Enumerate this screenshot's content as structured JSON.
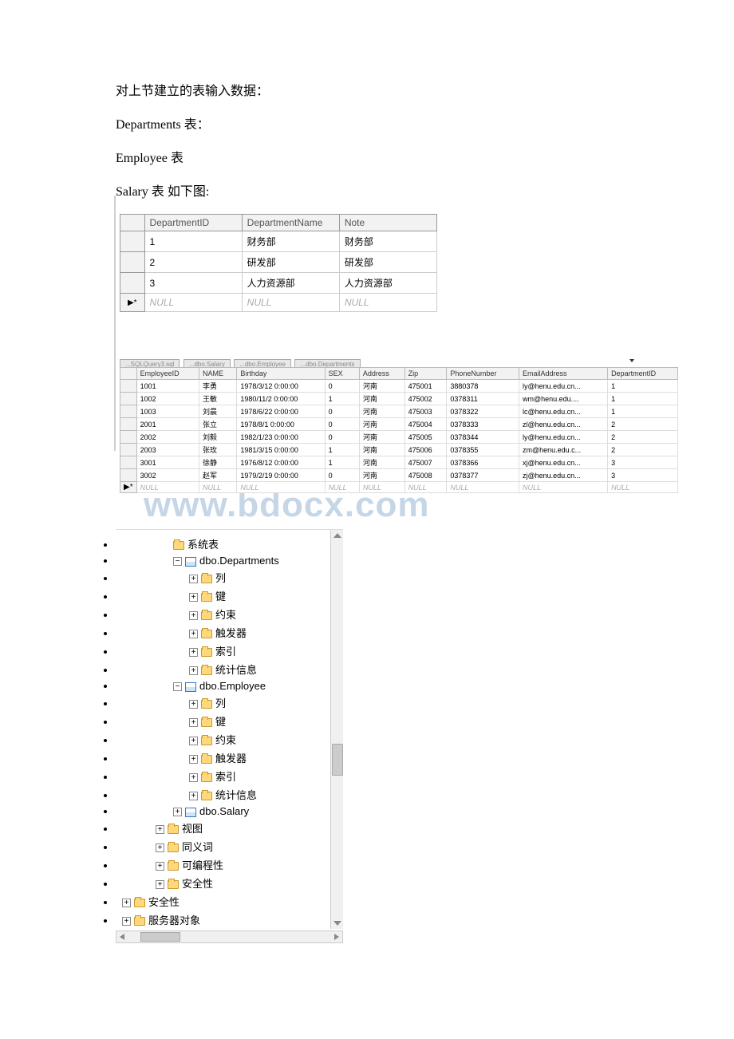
{
  "intro": {
    "line1": "对上节建立的表输入数据：",
    "line2": "Departments 表：",
    "line3": "Employee 表",
    "line4": "Salary 表 如下图:"
  },
  "watermark": "www.bdocx.com",
  "departments": {
    "headers": [
      "DepartmentID",
      "DepartmentName",
      "Note"
    ],
    "rows": [
      {
        "id": "1",
        "name": "财务部",
        "note": "财务部"
      },
      {
        "id": "2",
        "name": "研发部",
        "note": "研发部"
      },
      {
        "id": "3",
        "name": "人力资源部",
        "note": "人力资源部"
      }
    ],
    "null": "NULL",
    "marker": "▶*"
  },
  "employee_tabs": [
    "...SQLQuery3.sql",
    "...dbo.Salary",
    "...dbo.Employee",
    "...dbo.Departments"
  ],
  "employee": {
    "headers": [
      "EmployeeID",
      "NAME",
      "Birthday",
      "SEX",
      "Address",
      "Zip",
      "PhoneNumber",
      "EmailAddress",
      "DepartmentID"
    ],
    "rows": [
      {
        "id": "1001",
        "name": "李勇",
        "birthday": "1978/3/12 0:00:00",
        "sex": "0",
        "address": "河南",
        "zip": "475001",
        "phone": "3880378",
        "email": "ly@henu.edu.cn...",
        "dept": "1"
      },
      {
        "id": "1002",
        "name": "王敏",
        "birthday": "1980/11/2 0:00:00",
        "sex": "1",
        "address": "河南",
        "zip": "475002",
        "phone": "0378311",
        "email": "wm@henu.edu....",
        "dept": "1"
      },
      {
        "id": "1003",
        "name": "刘晨",
        "birthday": "1978/6/22 0:00:00",
        "sex": "0",
        "address": "河南",
        "zip": "475003",
        "phone": "0378322",
        "email": "lc@henu.edu.cn...",
        "dept": "1"
      },
      {
        "id": "2001",
        "name": "张立",
        "birthday": "1978/8/1 0:00:00",
        "sex": "0",
        "address": "河南",
        "zip": "475004",
        "phone": "0378333",
        "email": "zl@henu.edu.cn...",
        "dept": "2"
      },
      {
        "id": "2002",
        "name": "刘毅",
        "birthday": "1982/1/23 0:00:00",
        "sex": "0",
        "address": "河南",
        "zip": "475005",
        "phone": "0378344",
        "email": "ly@henu.edu.cn...",
        "dept": "2"
      },
      {
        "id": "2003",
        "name": "张玫",
        "birthday": "1981/3/15 0:00:00",
        "sex": "1",
        "address": "河南",
        "zip": "475006",
        "phone": "0378355",
        "email": "zm@henu.edu.c...",
        "dept": "2"
      },
      {
        "id": "3001",
        "name": "徐静",
        "birthday": "1976/8/12 0:00:00",
        "sex": "1",
        "address": "河南",
        "zip": "475007",
        "phone": "0378366",
        "email": "xj@henu.edu.cn...",
        "dept": "3"
      },
      {
        "id": "3002",
        "name": "赵军",
        "birthday": "1979/2/19 0:00:00",
        "sex": "0",
        "address": "河南",
        "zip": "475008",
        "phone": "0378377",
        "email": "zj@henu.edu.cn...",
        "dept": "3"
      }
    ],
    "null": "NULL",
    "marker": "▶*"
  },
  "tree": {
    "systables": "系统表",
    "dbo_departments": "dbo.Departments",
    "columns": "列",
    "keys": "键",
    "constraints": "约束",
    "triggers": "触发器",
    "indexes": "索引",
    "stats": "统计信息",
    "dbo_employee": "dbo.Employee",
    "dbo_salary": "dbo.Salary",
    "views": "视图",
    "synonyms": "同义词",
    "programmability": "可编程性",
    "security": "安全性",
    "security2": "安全性",
    "server_objects": "服务器对象"
  },
  "plus": "+",
  "minus": "−"
}
